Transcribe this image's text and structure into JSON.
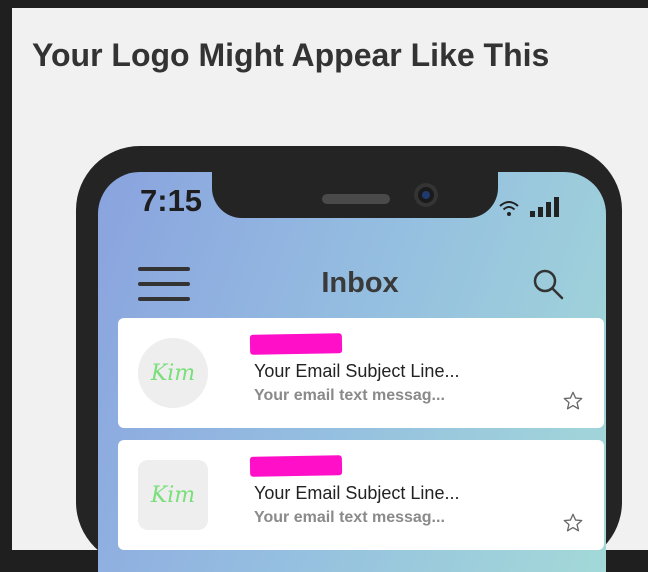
{
  "page": {
    "heading": "Your Logo Might Appear Like This"
  },
  "phone": {
    "status_time": "7:15",
    "icons": {
      "wifi": "wifi-icon",
      "signal": "signal-bars-icon"
    },
    "header": {
      "title": "Inbox",
      "menu_icon": "hamburger-menu-icon",
      "search_icon": "search-icon"
    },
    "emails": [
      {
        "avatar_text": "Kim",
        "sender_redacted": true,
        "subject": "Your Email Subject Line...",
        "preview": "Your email text messag...",
        "star_icon": "star-outline-icon"
      },
      {
        "avatar_text": "Kim",
        "sender_redacted": true,
        "subject": "Your Email Subject Line...",
        "preview": "Your email text messag...",
        "star_icon": "star-outline-icon"
      }
    ]
  },
  "colors": {
    "redaction": "#ff10c8",
    "avatar_text": "#7adf7a",
    "phone_frame": "#242424"
  }
}
